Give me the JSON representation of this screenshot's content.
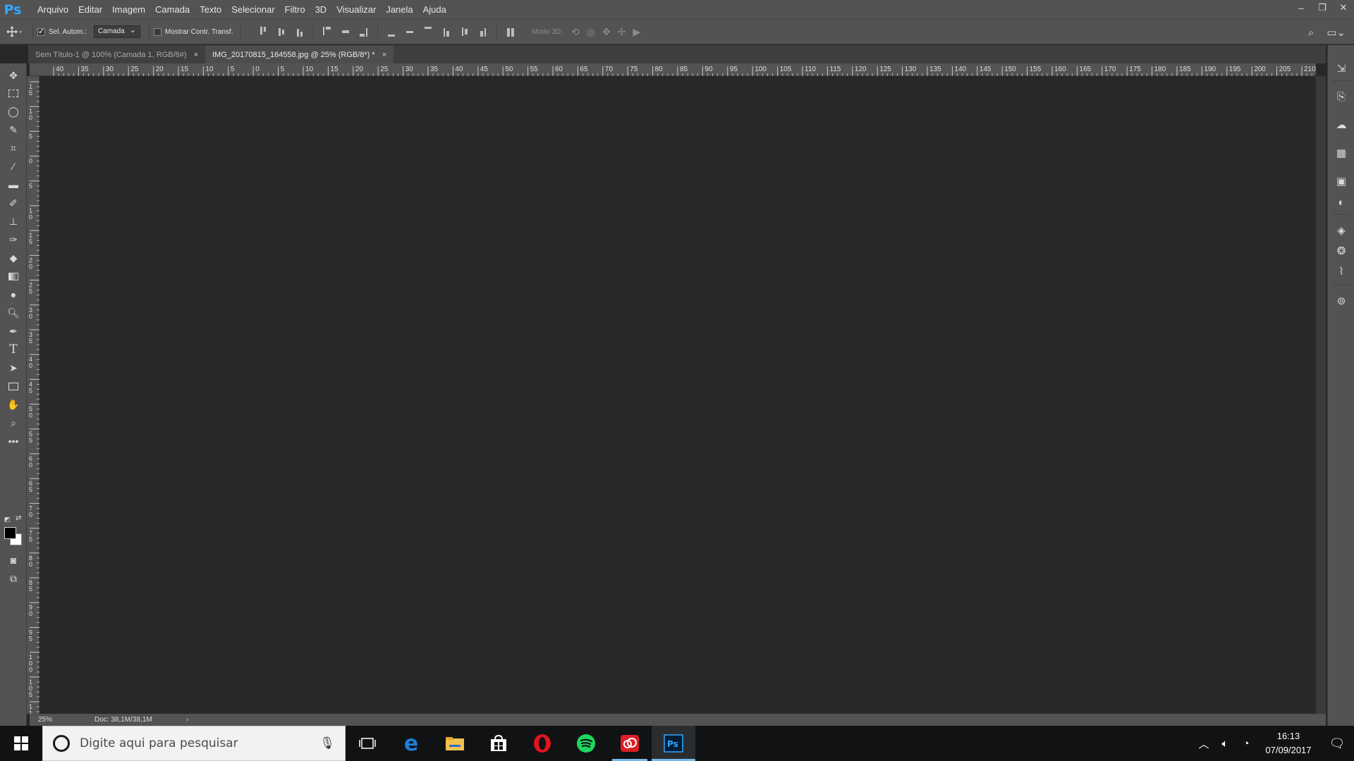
{
  "app": {
    "logo": "Ps",
    "menu": [
      "Arquivo",
      "Editar",
      "Imagem",
      "Camada",
      "Texto",
      "Selecionar",
      "Filtro",
      "3D",
      "Visualizar",
      "Janela",
      "Ajuda"
    ],
    "window_controls": {
      "minimize": "–",
      "restore": "❐",
      "close": "✕"
    }
  },
  "options_bar": {
    "tool_icon": "move-icon",
    "auto_select_label": "Sel. Autom.:",
    "auto_select_checked": true,
    "auto_select_target": "Camada",
    "show_transform_label": "Mostrar Contr. Transf.",
    "show_transform_checked": false,
    "mode_3d_label": "Modo 3D:"
  },
  "tabs": [
    {
      "label": "Sem Título-1 @ 100% (Camada 1, RGB/8#)",
      "active": false,
      "close": "×"
    },
    {
      "label": "IMG_20170815_164558.jpg @ 25% (RGB/8*) *",
      "active": true,
      "close": "×"
    }
  ],
  "ruler_top_labels": [
    "40",
    "35",
    "30",
    "25",
    "20",
    "15",
    "10",
    "5",
    "0",
    "5",
    "10",
    "15",
    "20",
    "25",
    "30",
    "35",
    "40",
    "45",
    "50",
    "55",
    "60",
    "65",
    "70",
    "75",
    "80",
    "85",
    "90",
    "95",
    "100",
    "105",
    "110",
    "115",
    "120",
    "125",
    "130",
    "135",
    "140",
    "145",
    "150",
    "155",
    "160",
    "165",
    "170",
    "175",
    "180",
    "185",
    "190",
    "195",
    "200",
    "205",
    "210"
  ],
  "ruler_left_labels": [
    "1\n5",
    "1\n0",
    "5",
    "0",
    "5",
    "1\n0",
    "1\n5",
    "2\n0",
    "2\n5",
    "3\n0",
    "3\n5",
    "4\n0",
    "4\n5",
    "5\n0",
    "5\n5",
    "6\n0",
    "6\n5",
    "7\n0",
    "7\n5",
    "8\n0",
    "8\n5",
    "9\n0",
    "9\n5",
    "1\n0\n0",
    "1\n0\n5",
    "1\n1"
  ],
  "status": {
    "zoom": "25%",
    "doc": "Doc: 38,1M/38,1M",
    "arrow": "›"
  },
  "taskbar": {
    "search_placeholder": "Digite aqui para pesquisar",
    "time": "16:13",
    "date": "07/09/2017"
  },
  "colors": {
    "accent_ps": "#31a8ff",
    "opera": "#e0141e",
    "spotify": "#1ed760",
    "creative_cloud": "#da1f26",
    "edge": "#1e7fd8"
  }
}
